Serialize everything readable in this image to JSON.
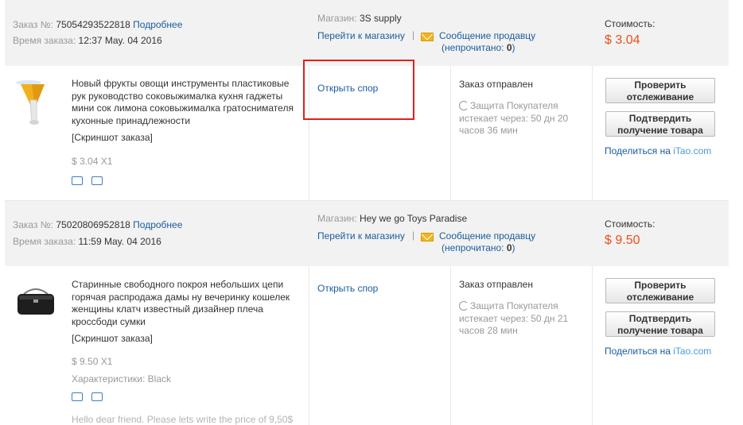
{
  "orders": [
    {
      "order_label": "Заказ №:",
      "order_number": "75054293522818",
      "details_link": "Подробнее",
      "time_label": "Время заказа:",
      "order_time": "12:37 May. 04 2016",
      "store_label": "Магазин:",
      "store_name": "3S supply",
      "go_store_link": "Перейти к магазину",
      "message_seller_link": "Сообщение продавцу",
      "unread_open": "(непрочитано: ",
      "unread_count": "0",
      "unread_close": ")",
      "cost_label": "Стоимость:",
      "cost_value": "$ 3.04",
      "product_title": "Новый фрукты овощи инструменты пластиковые рук руководство соковыжималка кухня гаджеты мини сок лимона соковыжималка гратоснимателя кухонные принадлежности",
      "snapshot_link": "[Скриншот заказа]",
      "price_qty": "$ 3.04 X1",
      "dispute_link": "Открыть спор",
      "status": "Заказ отправлен",
      "protection_line1": "Защита Покупателя",
      "protection_line2": "истекает через: 50 дн 20",
      "protection_line3": "часов 36 мин",
      "track_button": "Проверить отслеживание",
      "confirm_button": "Подтвердить получение товара",
      "share_text": "Поделиться на ",
      "share_site": "iTao.com"
    },
    {
      "order_label": "Заказ №:",
      "order_number": "75020806952818",
      "details_link": "Подробнее",
      "time_label": "Время заказа:",
      "order_time": "11:59 May. 04 2016",
      "store_label": "Магазин:",
      "store_name": "Hey we go Toys Paradise",
      "go_store_link": "Перейти к магазину",
      "message_seller_link": "Сообщение продавцу",
      "unread_open": "(непрочитано: ",
      "unread_count": "0",
      "unread_close": ")",
      "cost_label": "Стоимость:",
      "cost_value": "$ 9.50",
      "product_title": "Старинные свободного покроя небольших цепи горячая распродажа дамы ну вечеринку кошелек женщины клатч известный дизайнер плеча кроссбоди сумки",
      "snapshot_link": "[Скриншот заказа]",
      "price_qty": "$ 9.50 X1",
      "characteristics_label": "Характеристики:",
      "characteristics_value": "Black",
      "buyer_note": "Hello dear friend. Please lets write the price of 9,50$",
      "dispute_link": "Открыть спор",
      "status": "Заказ отправлен",
      "protection_line1": "Защита Покупателя",
      "protection_line2": "истекает через: 50 дн 21",
      "protection_line3": "часов 28 мин",
      "track_button": "Проверить отслеживание",
      "confirm_button": "Подтвердить получение товара",
      "share_text": "Поделиться на ",
      "share_site": "iTao.com"
    }
  ],
  "icons": {
    "truck": "truck-icon",
    "return": "return-icon",
    "mail": "envelope-icon",
    "clock": "clock-icon"
  },
  "colors": {
    "price": "#e8501a",
    "link": "#1a5c9e",
    "header_bg": "#f2f2f2",
    "highlight_box": "#e0201c"
  }
}
